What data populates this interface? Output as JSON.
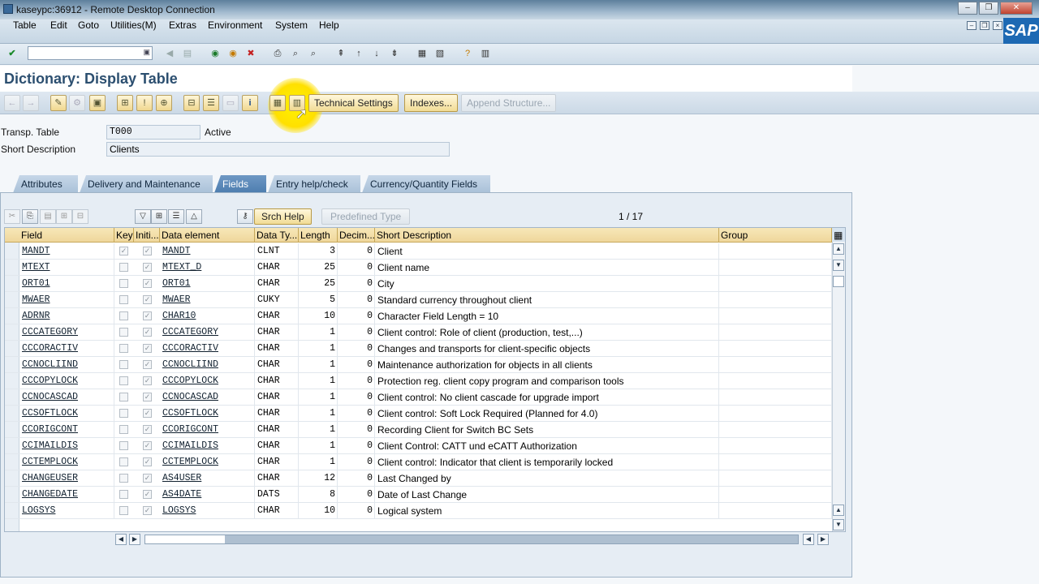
{
  "window": {
    "title": "kaseypc:36912 - Remote Desktop Connection"
  },
  "menu": [
    "Table",
    "Edit",
    "Goto",
    "Utilities(M)",
    "Extras",
    "Environment",
    "System",
    "Help"
  ],
  "brand": "SAP",
  "page_title": "Dictionary: Display Table",
  "app_toolbar": {
    "technical_settings": "Technical Settings",
    "indexes": "Indexes...",
    "append_structure": "Append Structure..."
  },
  "header": {
    "transp_label": "Transp. Table",
    "table_name": "T000",
    "status": "Active",
    "short_desc_label": "Short Description",
    "short_desc": "Clients"
  },
  "tabs": [
    "Attributes",
    "Delivery and Maintenance",
    "Fields",
    "Entry help/check",
    "Currency/Quantity Fields"
  ],
  "active_tab": "Fields",
  "fields_toolbar": {
    "srch_help": "Srch Help",
    "predefined_type": "Predefined Type",
    "pager": "1  /  17"
  },
  "columns": [
    "Field",
    "Key",
    "Initi...",
    "Data element",
    "Data Ty...",
    "Length",
    "Decim...",
    "Short Description",
    "Group"
  ],
  "rows": [
    {
      "field": "MANDT",
      "key": true,
      "init": true,
      "element": "MANDT",
      "type": "CLNT",
      "length": "3",
      "dec": "0",
      "desc": "Client"
    },
    {
      "field": "MTEXT",
      "key": false,
      "init": true,
      "element": "MTEXT_D",
      "type": "CHAR",
      "length": "25",
      "dec": "0",
      "desc": "Client name"
    },
    {
      "field": "ORT01",
      "key": false,
      "init": true,
      "element": "ORT01",
      "type": "CHAR",
      "length": "25",
      "dec": "0",
      "desc": "City"
    },
    {
      "field": "MWAER",
      "key": false,
      "init": true,
      "element": "MWAER",
      "type": "CUKY",
      "length": "5",
      "dec": "0",
      "desc": "Standard currency throughout client"
    },
    {
      "field": "ADRNR",
      "key": false,
      "init": true,
      "element": "CHAR10",
      "type": "CHAR",
      "length": "10",
      "dec": "0",
      "desc": "Character Field Length = 10"
    },
    {
      "field": "CCCATEGORY",
      "key": false,
      "init": true,
      "element": "CCCATEGORY",
      "type": "CHAR",
      "length": "1",
      "dec": "0",
      "desc": "Client control: Role of client (production, test,...)"
    },
    {
      "field": "CCCORACTIV",
      "key": false,
      "init": true,
      "element": "CCCORACTIV",
      "type": "CHAR",
      "length": "1",
      "dec": "0",
      "desc": "Changes and transports for client-specific objects"
    },
    {
      "field": "CCNOCLIIND",
      "key": false,
      "init": true,
      "element": "CCNOCLIIND",
      "type": "CHAR",
      "length": "1",
      "dec": "0",
      "desc": "Maintenance authorization for objects in all clients"
    },
    {
      "field": "CCCOPYLOCK",
      "key": false,
      "init": true,
      "element": "CCCOPYLOCK",
      "type": "CHAR",
      "length": "1",
      "dec": "0",
      "desc": "Protection reg. client copy program and comparison tools"
    },
    {
      "field": "CCNOCASCAD",
      "key": false,
      "init": true,
      "element": "CCNOCASCAD",
      "type": "CHAR",
      "length": "1",
      "dec": "0",
      "desc": "Client control: No client cascade for upgrade import"
    },
    {
      "field": "CCSOFTLOCK",
      "key": false,
      "init": true,
      "element": "CCSOFTLOCK",
      "type": "CHAR",
      "length": "1",
      "dec": "0",
      "desc": "Client control: Soft Lock Required (Planned for 4.0)"
    },
    {
      "field": "CCORIGCONT",
      "key": false,
      "init": true,
      "element": "CCORIGCONT",
      "type": "CHAR",
      "length": "1",
      "dec": "0",
      "desc": "Recording Client for Switch BC Sets"
    },
    {
      "field": "CCIMAILDIS",
      "key": false,
      "init": true,
      "element": "CCIMAILDIS",
      "type": "CHAR",
      "length": "1",
      "dec": "0",
      "desc": "Client Control: CATT und eCATT Authorization"
    },
    {
      "field": "CCTEMPLOCK",
      "key": false,
      "init": true,
      "element": "CCTEMPLOCK",
      "type": "CHAR",
      "length": "1",
      "dec": "0",
      "desc": "Client control: Indicator that client is temporarily locked"
    },
    {
      "field": "CHANGEUSER",
      "key": false,
      "init": true,
      "element": "AS4USER",
      "type": "CHAR",
      "length": "12",
      "dec": "0",
      "desc": "Last Changed by"
    },
    {
      "field": "CHANGEDATE",
      "key": false,
      "init": true,
      "element": "AS4DATE",
      "type": "DATS",
      "length": "8",
      "dec": "0",
      "desc": "Date of Last Change"
    },
    {
      "field": "LOGSYS",
      "key": false,
      "init": true,
      "element": "LOGSYS",
      "type": "CHAR",
      "length": "10",
      "dec": "0",
      "desc": "Logical system"
    }
  ]
}
